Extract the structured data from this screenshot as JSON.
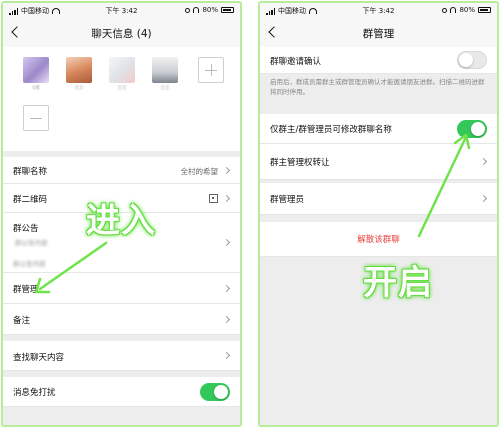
{
  "colors": {
    "accent_green": "#34c759",
    "danger_red": "#e64340",
    "overlay_green": "#57d936"
  },
  "left": {
    "status": {
      "carrier": "中国移动",
      "time": "下午 3:42",
      "battery": "80%"
    },
    "nav_title": "聊天信息 (4)",
    "members": [
      {
        "name": "Q家"
      },
      {
        "name": "兰兰"
      },
      {
        "name": "兰兰"
      },
      {
        "name": "兰兰"
      }
    ],
    "rows": {
      "group_name_label": "群聊名称",
      "group_name_value": "全村的希望",
      "qrcode_label": "群二维码",
      "notice_label": "群公告",
      "notice_blur": "群公告内容",
      "notice_blur2": "群公告内容",
      "manage_label": "群管理",
      "remark_label": "备注",
      "search_label": "查找聊天内容",
      "mute_label": "消息免打扰"
    },
    "overlay_word": "进入"
  },
  "right": {
    "status": {
      "carrier": "中国移动",
      "time": "下午 3:42",
      "battery": "80%"
    },
    "nav_title": "群管理",
    "invite_confirm_label": "群聊邀请确认",
    "invite_desc": "启用后，群成员需群主或群管理员确认才能邀请朋友进群。扫描二维码进群将同时停用。",
    "rename_label": "仅群主/群管理员可修改群聊名称",
    "transfer_label": "群主管理权转让",
    "admins_label": "群管理员",
    "dissolve_label": "解散该群聊",
    "overlay_word": "开启"
  },
  "toggles": {
    "invite_confirm_on": false,
    "rename_restrict_on": true,
    "mute_on": true
  }
}
